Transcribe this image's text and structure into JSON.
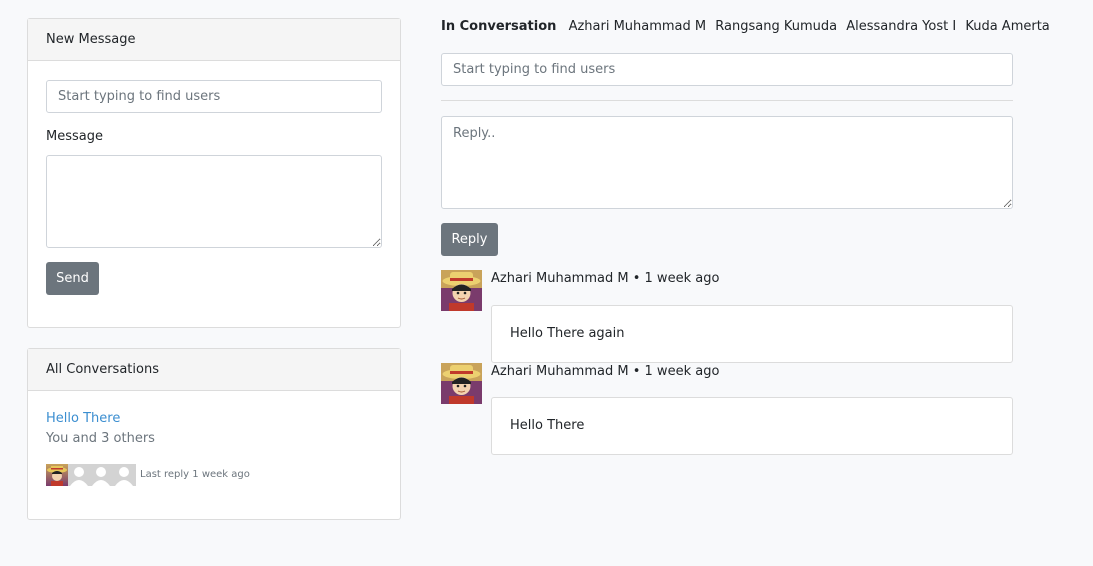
{
  "new_message": {
    "header": "New Message",
    "recipient_placeholder": "Start typing to find users",
    "message_label": "Message",
    "message_value": "",
    "send_label": "Send"
  },
  "all_conversations": {
    "header": "All Conversations",
    "items": [
      {
        "subject": "Hello There",
        "participants_summary": "You and 3 others",
        "last_reply": "Last reply 1 week ago"
      }
    ]
  },
  "conversation": {
    "in_conversation_label": "In Conversation",
    "participants": [
      "Azhari Muhammad M",
      "Rangsang Kumuda",
      "Alessandra Yost I",
      "Kuda Amerta"
    ],
    "add_user_placeholder": "Start typing to find users",
    "reply_placeholder": "Reply..",
    "reply_label": "Reply",
    "messages": [
      {
        "author": "Azhari Muhammad M",
        "separator": "•",
        "time": "1 week ago",
        "body": "Hello There again"
      },
      {
        "author": "Azhari Muhammad M",
        "separator": "•",
        "time": "1 week ago",
        "body": "Hello There"
      }
    ]
  },
  "colors": {
    "button": "#6c757d",
    "link": "#3b8ed0",
    "background": "#f8f9fb"
  }
}
